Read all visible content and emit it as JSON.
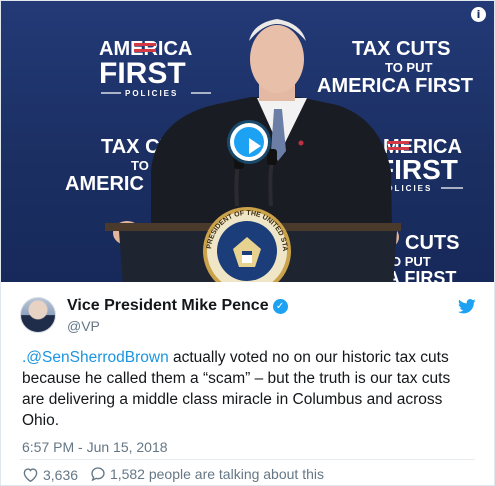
{
  "media": {
    "left_sign": {
      "line1": "AMERICA",
      "line2": "FIRST",
      "line3": "POLICIES"
    },
    "right_sign": {
      "line1": "TAX CUTS",
      "line2": "TO PUT",
      "line3": "AMERICA FIRST"
    },
    "mid_left_sign": {
      "line1": "TAX CU",
      "line2": "TO P",
      "line3": "AMERIC"
    },
    "mid_right_sign": {
      "line1": "MERICA",
      "line2": "FIRST",
      "line3": "POLICIES"
    },
    "low_right_sign": {
      "line1": "CUTS",
      "line2": "O PUT",
      "line3": "A FIRST"
    },
    "seal_text": "PRESIDENT OF THE UNITED STATES",
    "info_icon": "info-icon",
    "play_icon": "play-icon"
  },
  "author": {
    "name": "Vice President Mike Pence",
    "handle": "@VP",
    "verified_icon": "verified-badge-icon",
    "avatar_icon": "avatar"
  },
  "tweet": {
    "mention": ".@SenSherrodBrown",
    "text": " actually voted no on our historic tax cuts because he called them a “scam” – but the truth is our tax cuts are delivering a middle class miracle in Columbus and across Ohio.",
    "timestamp": "6:57 PM - Jun 15, 2018"
  },
  "actions": {
    "likes": "3,636",
    "talking": "1,582 people are talking about this"
  },
  "colors": {
    "twitter_blue": "#1da1f2",
    "link": "#1b95e0",
    "secondary_text": "#657786",
    "stage_blue": "#1b2f63",
    "sign_red": "#d33a45"
  }
}
